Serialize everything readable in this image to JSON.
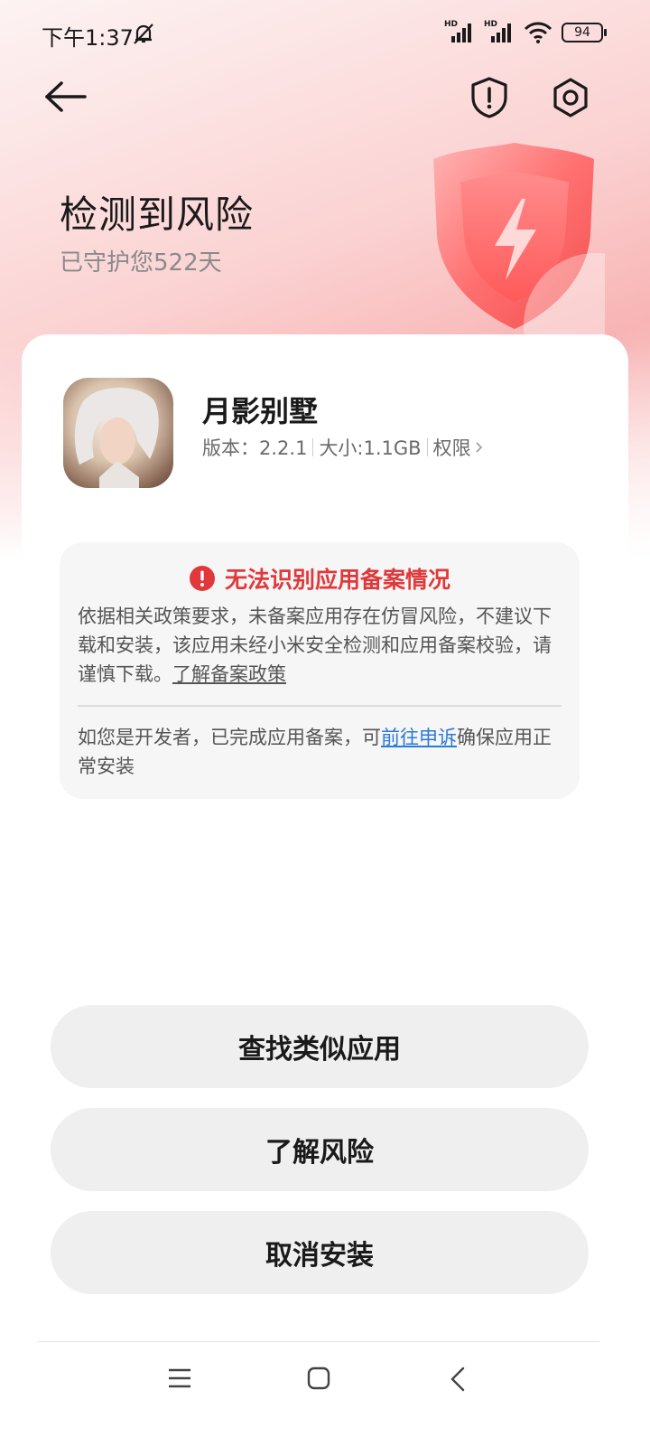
{
  "status_bar": {
    "time": "下午1:37",
    "battery": "94",
    "signal_label_1": "HD",
    "signal_label_2": "HD"
  },
  "header": {
    "back_icon": "arrow-left-icon",
    "security_icon": "shield-alert-icon",
    "settings_icon": "gear-icon"
  },
  "hero": {
    "title": "检测到风险",
    "subtitle": "已守护您522天",
    "decoration_icon": "shield-lightning-icon"
  },
  "app": {
    "name": "月影别墅",
    "version_label": "版本：2.2.1",
    "size_label": "大小:1.1GB",
    "permissions_label": "权限"
  },
  "warning": {
    "title": "无法识别应用备案情况",
    "body": "依据相关政策要求，未备案应用存在仿冒风险，不建议下载和安装，该应用未经小米安全检测和应用备案校验，请谨慎下载。",
    "policy_link": "了解备案政策",
    "dev_prefix": "如您是开发者，已完成应用备案，可",
    "appeal_link": "前往申诉",
    "dev_suffix": "确保应用正常安装"
  },
  "actions": {
    "find_similar": "查找类似应用",
    "learn_risk": "了解风险",
    "cancel_install": "取消安装"
  },
  "colors": {
    "danger": "#e0383b",
    "link": "#2a7ad6",
    "button_bg": "#efefef"
  }
}
